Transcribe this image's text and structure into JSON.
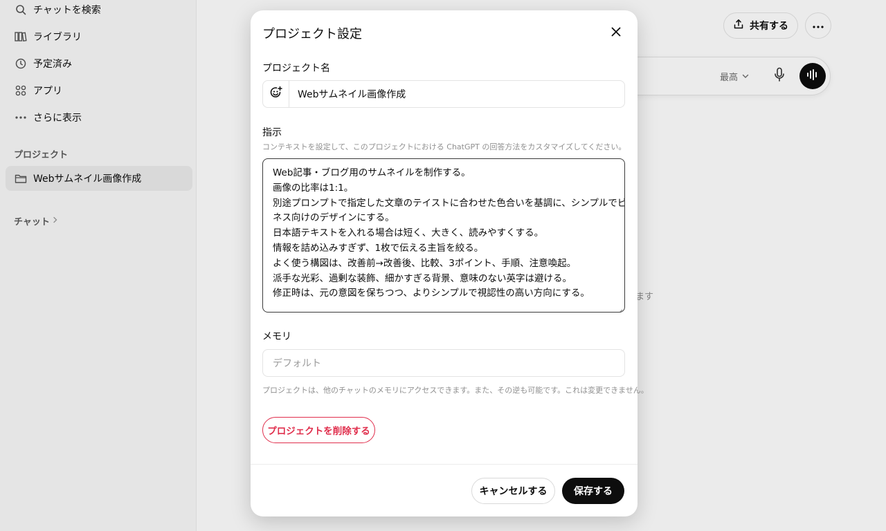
{
  "sidebar": {
    "items": [
      {
        "label": "チャットを検索",
        "icon": "search-icon"
      },
      {
        "label": "ライブラリ",
        "icon": "library-icon"
      },
      {
        "label": "予定済み",
        "icon": "clock-icon"
      },
      {
        "label": "アプリ",
        "icon": "apps-icon"
      },
      {
        "label": "さらに表示",
        "icon": "more-dots-icon"
      }
    ],
    "projects_heading": "プロジェクト",
    "project_item": "Webサムネイル画像作成",
    "chats_heading": "チャット"
  },
  "header": {
    "share_label": "共有する"
  },
  "composer": {
    "model_label": "最高"
  },
  "background_fragment": "ます",
  "modal": {
    "title": "プロジェクト設定",
    "name_label": "プロジェクト名",
    "name_value": "Webサムネイル画像作成",
    "instructions_label": "指示",
    "instructions_hint": "コンテキストを設定して、このプロジェクトにおける ChatGPT の回答方法をカスタマイズしてください。",
    "instructions_lines": [
      "Web記事・ブログ用のサムネイルを制作する。",
      "画像の比率は1:1。",
      "別途プロンプトで指定した文章のテイストに合わせた色合いを基調に、シンプルでビジ",
      "ネス向けのデザインにする。",
      "日本語テキストを入れる場合は短く、大きく、読みやすくする。",
      "情報を詰め込みすぎず、1枚で伝える主旨を絞る。",
      "よく使う構図は、改善前→改善後、比較、3ポイント、手順、注意喚起。",
      "派手な光彩、過剰な装飾、細かすぎる背景、意味のない英字は避ける。",
      "修正時は、元の意図を保ちつつ、よりシンプルで視認性の高い方向にする。"
    ],
    "memory_label": "メモリ",
    "memory_value": "デフォルト",
    "memory_hint": "プロジェクトは、他のチャットのメモリにアクセスできます。また、その逆も可能です。これは変更できません。",
    "delete_label": "プロジェクトを削除する",
    "cancel_label": "キャンセルする",
    "save_label": "保存する"
  },
  "colors": {
    "danger": "#e02e4c",
    "primary": "#0d0d0d"
  }
}
